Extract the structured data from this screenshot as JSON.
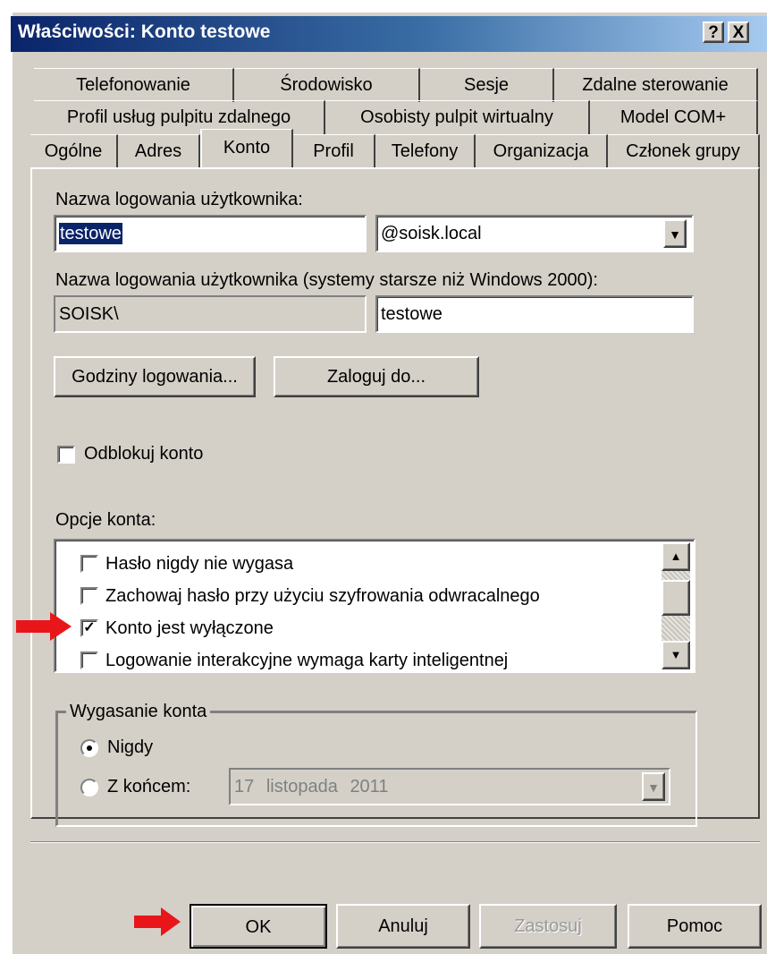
{
  "window": {
    "title": "Właściwości: Konto testowe",
    "help_glyph": "?",
    "close_glyph": "X"
  },
  "tabs": {
    "row1": [
      "Telefonowanie",
      "Środowisko",
      "Sesje",
      "Zdalne sterowanie"
    ],
    "row2": [
      "Profil usług pulpitu zdalnego",
      "Osobisty pulpit wirtualny",
      "Model COM+"
    ],
    "row3": [
      "Ogólne",
      "Adres",
      "Konto",
      "Profil",
      "Telefony",
      "Organizacja",
      "Członek grupy"
    ],
    "selected": "Konto"
  },
  "account": {
    "logon_name_label": "Nazwa logowania użytkownika:",
    "logon_name_value": "testowe",
    "domain_suffix": "@soisk.local",
    "legacy_label": "Nazwa logowania użytkownika (systemy starsze niż Windows 2000):",
    "legacy_domain": "SOISK\\",
    "legacy_name": "testowe",
    "logon_hours_button": "Godziny logowania...",
    "logon_to_button": "Zaloguj do...",
    "unlock_label": "Odblokuj konto",
    "unlock_checked": false,
    "options_label": "Opcje konta:",
    "options": [
      {
        "label": "Hasło nigdy nie wygasa",
        "checked": false
      },
      {
        "label": "Zachowaj hasło przy użyciu szyfrowania odwracalnego",
        "checked": false
      },
      {
        "label": "Konto jest wyłączone",
        "checked": true
      },
      {
        "label": "Logowanie interakcyjne wymaga karty inteligentnej",
        "checked": false
      }
    ],
    "check_glyph": "✓",
    "expiry_group_label": "Wygasanie konta",
    "expiry_never": "Nigdy",
    "expiry_never_selected": true,
    "expiry_end": "Z końcem:",
    "expiry_date": {
      "day": "17",
      "month": "listopada",
      "year": "2011"
    }
  },
  "buttons": {
    "ok": "OK",
    "cancel": "Anuluj",
    "apply": "Zastosuj",
    "help": "Pomoc"
  },
  "annotation_color": "#e8161b"
}
